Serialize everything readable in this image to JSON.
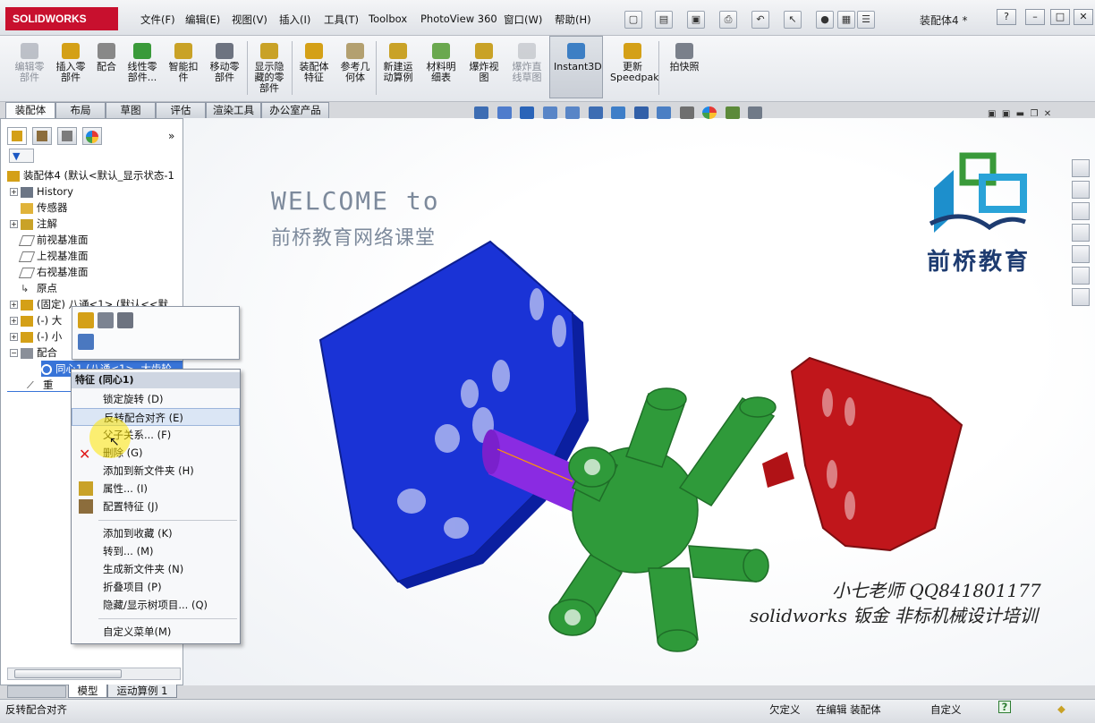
{
  "app": {
    "logo_text": "SOLIDWORKS",
    "document_title": "装配体4 *"
  },
  "menu": [
    "文件(F)",
    "编辑(E)",
    "视图(V)",
    "插入(I)",
    "工具(T)",
    "Toolbox",
    "PhotoView 360",
    "窗口(W)",
    "帮助(H)"
  ],
  "window_controls": [
    "?",
    "–",
    "□",
    "✕"
  ],
  "commands": [
    {
      "label": "编辑零\n部件",
      "enabled": false
    },
    {
      "label": "插入零\n部件",
      "enabled": true
    },
    {
      "label": "配合",
      "enabled": true
    },
    {
      "label": "线性零\n部件...",
      "enabled": true
    },
    {
      "label": "智能扣\n件",
      "enabled": true
    },
    {
      "label": "移动零\n部件",
      "enabled": true
    },
    {
      "label": "显示隐\n藏的零\n部件",
      "enabled": true
    },
    {
      "label": "装配体\n特征",
      "enabled": true
    },
    {
      "label": "参考几\n何体",
      "enabled": true
    },
    {
      "label": "新建运\n动算例",
      "enabled": true
    },
    {
      "label": "材料明\n细表",
      "enabled": true
    },
    {
      "label": "爆炸视\n图",
      "enabled": true
    },
    {
      "label": "爆炸直\n线草图",
      "enabled": false
    },
    {
      "label": "Instant3D",
      "enabled": true
    },
    {
      "label": "更新\nSpeedpak",
      "enabled": true
    },
    {
      "label": "拍快照",
      "enabled": true
    }
  ],
  "cmd_tabs": [
    "装配体",
    "布局",
    "草图",
    "评估",
    "渲染工具",
    "办公室产品"
  ],
  "tree": {
    "root": "装配体4 (默认<默认_显示状态-1",
    "items": [
      "History",
      "传感器",
      "注解",
      "前视基准面",
      "上视基准面",
      "右视基准面",
      "原点",
      "(固定) 八通<1> (默认<<默",
      "(-) 大",
      "(-) 小",
      "配合",
      "同心1 (八通<1>, 大齿轮",
      "重"
    ]
  },
  "viewport_text": {
    "welcome": "WELCOME to",
    "school": "前桥教育网络课堂",
    "brand": "前桥教育",
    "teacher": "小七老师 QQ841801177",
    "course": "solidworks 钣金 非标机械设计培训"
  },
  "context_menu": {
    "header": "特征 (同心1)",
    "items": [
      {
        "label": "锁定旋转 (D)",
        "highlight": false
      },
      {
        "label": "反转配合对齐 (E)",
        "highlight": true
      },
      {
        "label": "父子关系... (F)",
        "highlight": false
      },
      {
        "label": "删除 (G)",
        "highlight": false
      },
      {
        "label": "添加到新文件夹 (H)",
        "highlight": false
      },
      {
        "label": "属性... (I)",
        "highlight": false
      },
      {
        "label": "配置特征 (J)",
        "highlight": false
      },
      {
        "label": "添加到收藏 (K)",
        "highlight": false
      },
      {
        "label": "转到... (M)",
        "highlight": false
      },
      {
        "label": "生成新文件夹 (N)",
        "highlight": false
      },
      {
        "label": "折叠项目 (P)",
        "highlight": false
      },
      {
        "label": "隐藏/显示树项目... (Q)",
        "highlight": false
      },
      {
        "label": "自定义菜单(M)",
        "highlight": false
      }
    ]
  },
  "bottom_tabs": [
    "模型",
    "运动算例 1"
  ],
  "status": {
    "left": "反转配合对齐",
    "underdefined": "欠定义",
    "editing": "在编辑 装配体",
    "custom": "自定义",
    "help": "?"
  },
  "colors": {
    "blue_gear": "#1a33d6",
    "red_gear": "#c0161b",
    "green_cross": "#2f9a3a",
    "pin": "#8a2be2",
    "brand": "#1d3b70"
  }
}
